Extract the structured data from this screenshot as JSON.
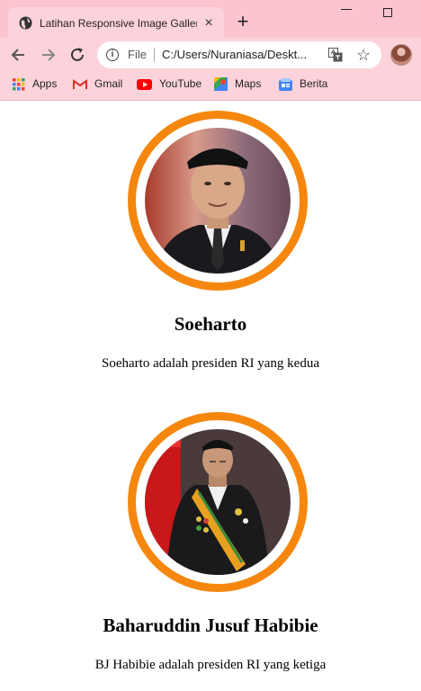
{
  "browser": {
    "tab_title": "Latihan Responsive Image Gallery",
    "tab_close": "×",
    "new_tab": "+",
    "url_scheme": "File",
    "url": "C:/Users/Nuraniasa/Deskt...",
    "icons": {
      "back": "arrow-left-icon",
      "forward": "arrow-right-icon",
      "reload": "reload-icon",
      "info": "info-icon",
      "translate": "translate-icon",
      "bookmark": "star-icon"
    }
  },
  "bookmarks": [
    {
      "label": "Apps"
    },
    {
      "label": "Gmail"
    },
    {
      "label": "YouTube"
    },
    {
      "label": "Maps"
    },
    {
      "label": "Berita"
    }
  ],
  "gallery": [
    {
      "name": "Soeharto",
      "description": "Soeharto adalah presiden RI yang kedua"
    },
    {
      "name": "Baharuddin Jusuf Habibie",
      "description": "BJ Habibie adalah presiden RI yang ketiga"
    }
  ],
  "colors": {
    "chrome_bg": "#fdd3db",
    "tabstrip_bg": "#fcc4ce",
    "ring": "#f5870f"
  }
}
